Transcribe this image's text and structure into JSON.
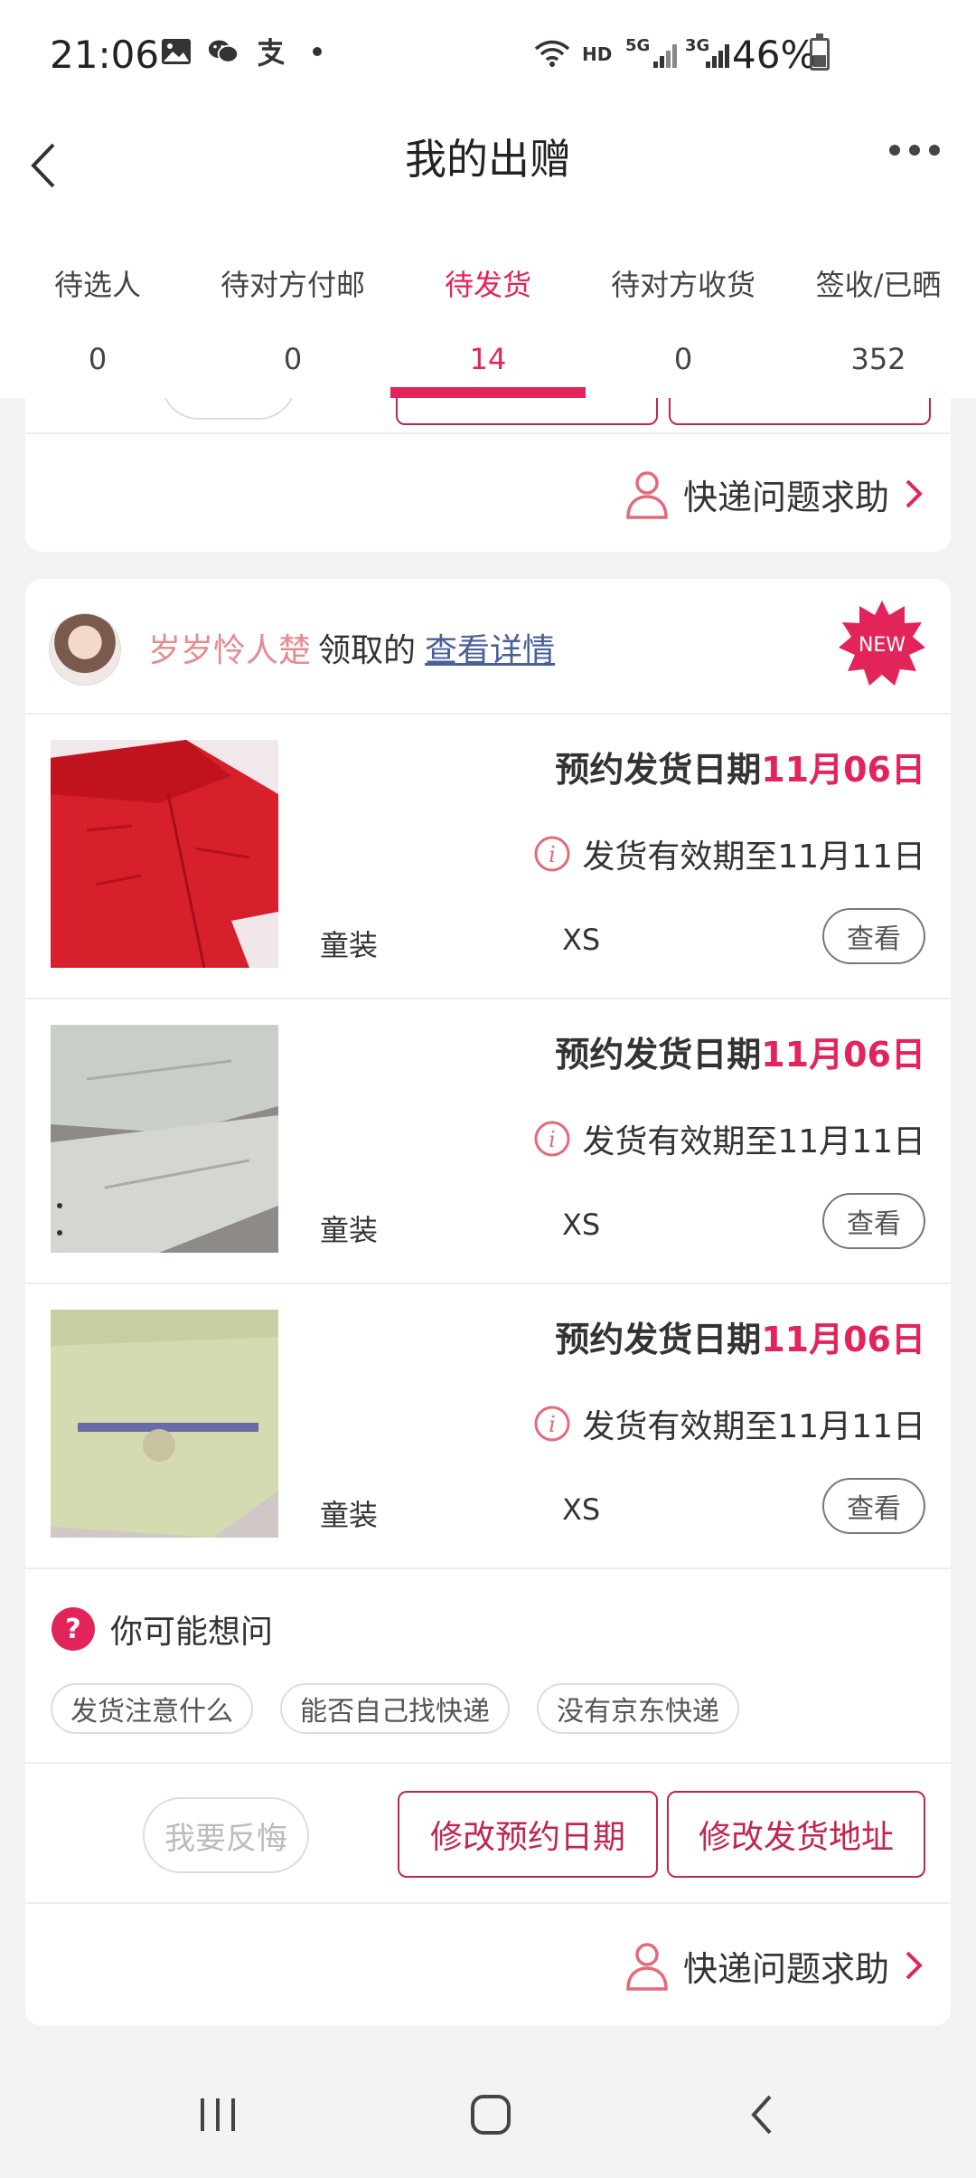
{
  "status_bar": {
    "time": "21:06",
    "battery": "46%",
    "battery_level": 0.46,
    "network_labels": [
      "HD",
      "5G",
      "3G"
    ],
    "icons": [
      "image-icon",
      "wechat-icon",
      "alipay-icon",
      "dot-icon",
      "wifi-icon",
      "signal-icon",
      "battery-icon"
    ]
  },
  "nav": {
    "title": "我的出赠",
    "back_icon": "chevron-left-icon",
    "more_icon": "more-dots-icon"
  },
  "tabs": [
    {
      "label": "待选人",
      "count": "0",
      "active": false
    },
    {
      "label": "待对方付邮",
      "count": "0",
      "active": false
    },
    {
      "label": "待发货",
      "count": "14",
      "active": true
    },
    {
      "label": "待对方收货",
      "count": "0",
      "active": false
    },
    {
      "label": "签收/已晒",
      "count": "352",
      "active": false
    }
  ],
  "help": {
    "label": "快递问题求助",
    "icon": "person-icon"
  },
  "card": {
    "receiver": "岁岁怜人楚",
    "verb": "领取的",
    "detail_link": "查看详情",
    "badge": "NEW",
    "items": [
      {
        "date_label": "预约发货日期",
        "date": "11月06日",
        "expire": "发货有效期至11月11日",
        "category": "童装",
        "size": "XS",
        "view": "查看",
        "image": "red-jacket-photo"
      },
      {
        "date_label": "预约发货日期",
        "date": "11月06日",
        "expire": "发货有效期至11月11日",
        "category": "童装",
        "size": "XS",
        "view": "查看",
        "image": "grey-jeans-photo"
      },
      {
        "date_label": "预约发货日期",
        "date": "11月06日",
        "expire": "发货有效期至11月11日",
        "category": "童装",
        "size": "XS",
        "view": "查看",
        "image": "green-shirt-photo"
      }
    ],
    "faq": {
      "title": "你可能想问",
      "chips": [
        "发货注意什么",
        "能否自己找快递",
        "没有京东快递"
      ]
    },
    "actions": {
      "regret": "我要反悔",
      "change_date": "修改预约日期",
      "change_address": "修改发货地址"
    }
  },
  "colors": {
    "accent": "#e3245a",
    "button_border": "#c2254f",
    "link": "#4a5f98",
    "receiver": "#e68a90"
  }
}
